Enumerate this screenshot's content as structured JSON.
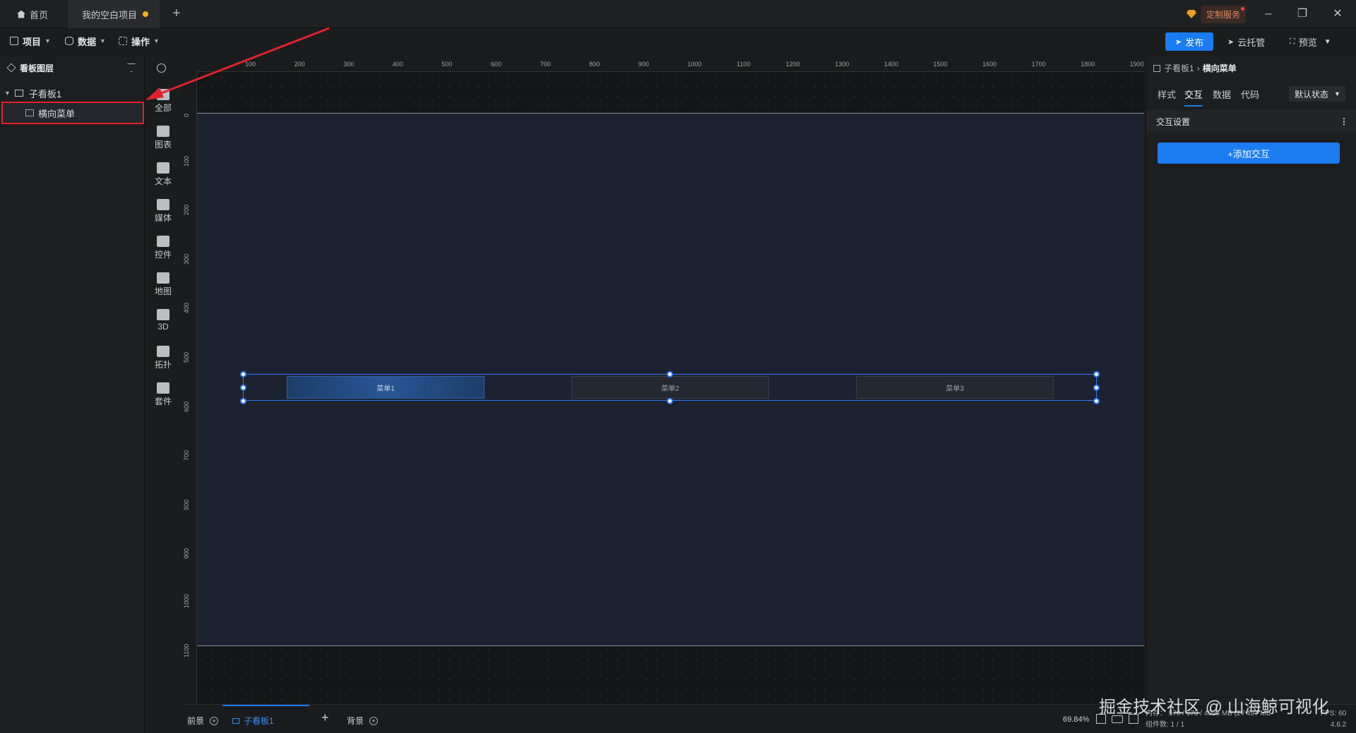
{
  "titlebar": {
    "home_tab": "首页",
    "project_tab": "我的空白项目",
    "custom_service": "定制服务"
  },
  "menubar": {
    "project": "项目",
    "data": "数据",
    "operate": "操作",
    "publish": "发布",
    "cloud": "云托管",
    "preview": "预览"
  },
  "layers": {
    "title": "看板图层",
    "parent": "子看板1",
    "child": "横向菜单"
  },
  "toolbox": [
    {
      "label": "全部"
    },
    {
      "label": "图表"
    },
    {
      "label": "文本"
    },
    {
      "label": "媒体"
    },
    {
      "label": "控件"
    },
    {
      "label": "地图"
    },
    {
      "label": "3D"
    },
    {
      "label": "拓扑"
    },
    {
      "label": "套件"
    }
  ],
  "ruler": {
    "h": [
      "100",
      "200",
      "300",
      "400",
      "500",
      "600",
      "700",
      "800",
      "900",
      "1000",
      "1100",
      "1200",
      "1300",
      "1400",
      "1500",
      "1600",
      "1700",
      "1800",
      "1900"
    ],
    "v": [
      "0",
      "100",
      "200",
      "300",
      "400",
      "500",
      "600",
      "700",
      "800",
      "900",
      "1000",
      "1100"
    ]
  },
  "canvas": {
    "menu_items": [
      "菜单1",
      "菜单2",
      "菜单3"
    ]
  },
  "rpanel": {
    "crumb_parent": "子看板1",
    "crumb_current": "横向菜单",
    "tabs": [
      "样式",
      "交互",
      "数据",
      "代码"
    ],
    "active_tab": "交互",
    "state": "默认状态",
    "section": "交互设置",
    "add_button": "+添加交互"
  },
  "bottom": {
    "foreground": "前景",
    "board": "子看板1",
    "background": "背景",
    "zoom": "69.84%",
    "memory": "内存： 570 / 570 / 4096 MB (2 / 497 MB",
    "component_count": "组件数: 1 / 1",
    "fps": "FPS: 60",
    "version": "4.6.2"
  },
  "watermark": "掘金技术社区 @ 山海鲸可视化"
}
